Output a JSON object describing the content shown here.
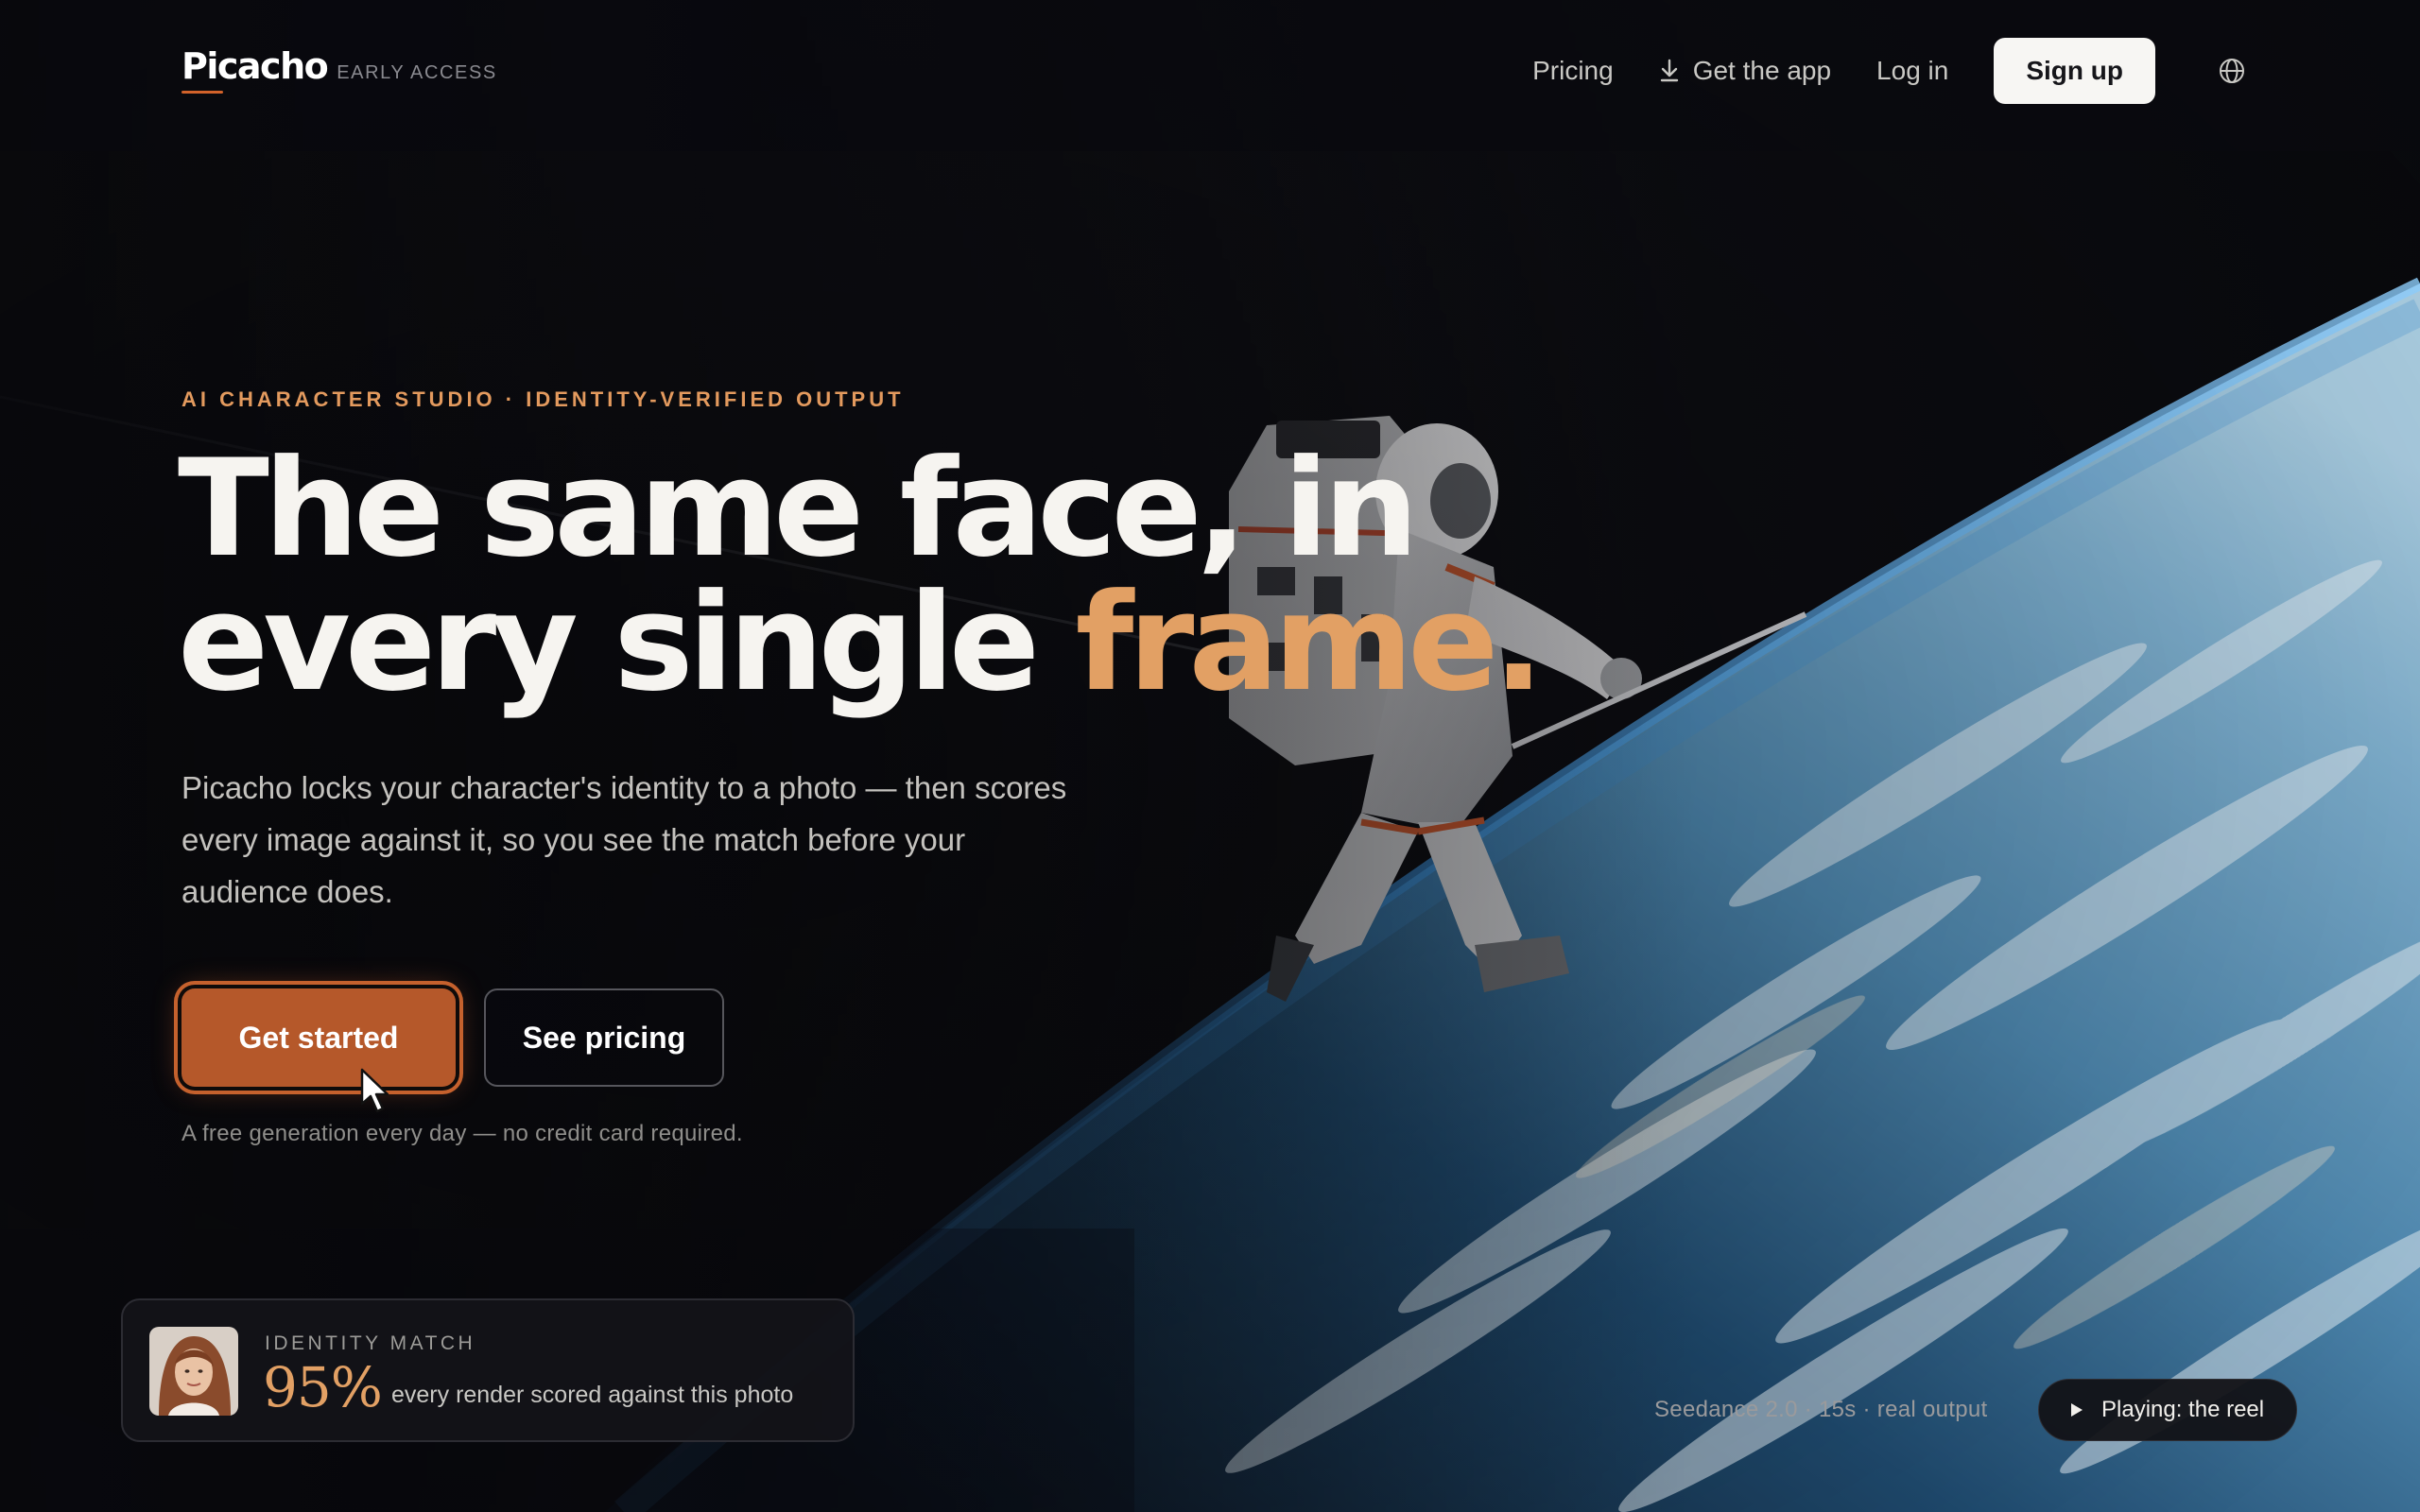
{
  "brand": {
    "name": "Picacho",
    "badge": "EARLY ACCESS",
    "accent_color": "#d2622a",
    "highlight_color": "#e2a064"
  },
  "nav": {
    "pricing": "Pricing",
    "get_app": "Get the app",
    "get_app_icon": "download-icon",
    "login": "Log in",
    "signup": "Sign up",
    "language_icon": "globe-icon"
  },
  "hero": {
    "eyebrow": "AI CHARACTER STUDIO · IDENTITY-VERIFIED OUTPUT",
    "headline_line1": "The same face, in",
    "headline_line2_start": "every single ",
    "headline_line2_accent": "frame.",
    "subcopy": "Picacho locks your character's identity to a photo — then scores every image against it, so you see the match before your audience does.",
    "primary_cta": "Get started",
    "secondary_cta": "See pricing",
    "fine_print": "A free generation every day — no credit card required."
  },
  "identity_card": {
    "label": "IDENTITY MATCH",
    "score": "95%",
    "description": "every render scored against this photo"
  },
  "reel": {
    "meta": "Seedance 2.0 · 15s · real output",
    "status": "Playing: the reel",
    "status_icon": "play-icon"
  }
}
